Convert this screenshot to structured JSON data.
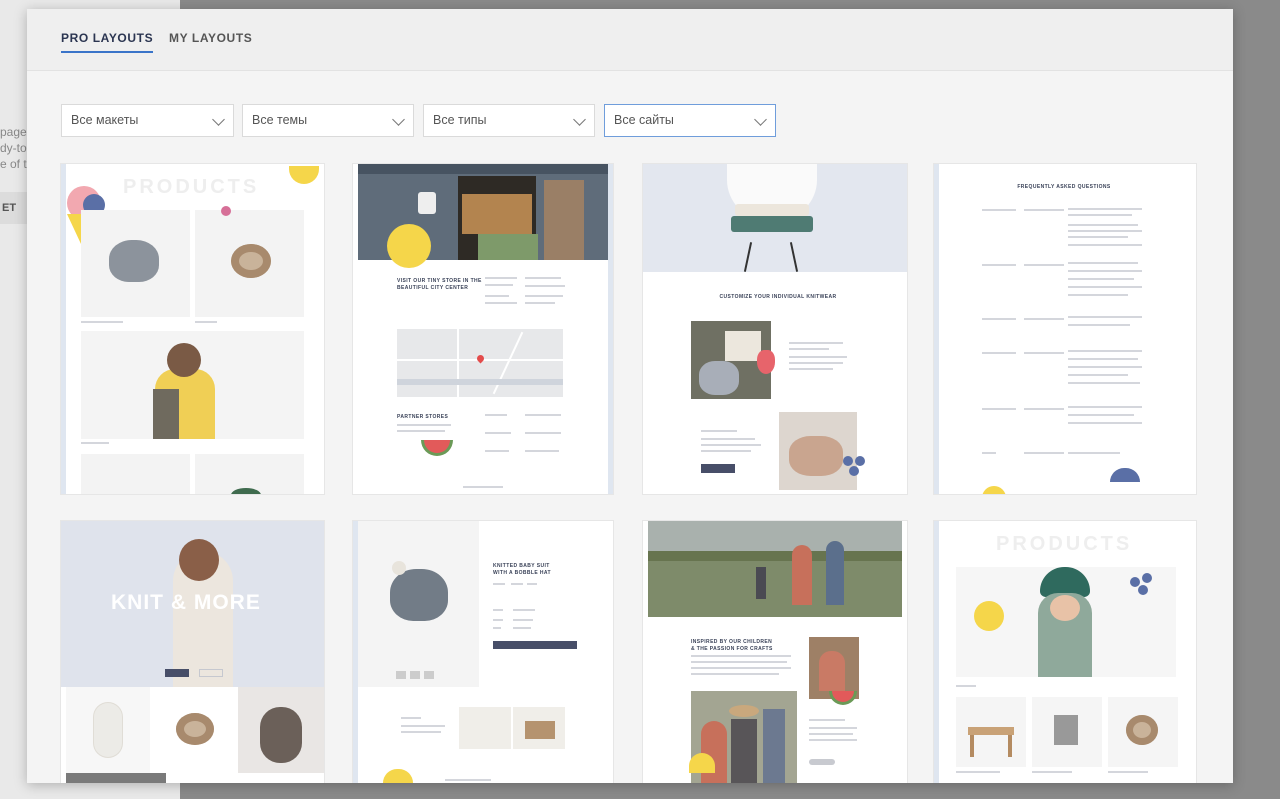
{
  "background_page": {
    "fragments": [
      "page.",
      "dy-to-",
      "e of t"
    ],
    "button_label": "ET"
  },
  "tabs": [
    {
      "label": "PRO LAYOUTS",
      "active": true
    },
    {
      "label": "MY LAYOUTS",
      "active": false
    }
  ],
  "filters": [
    {
      "value": "Все макеты"
    },
    {
      "value": "Все темы"
    },
    {
      "value": "Все типы"
    },
    {
      "value": "Все сайты",
      "focused": true
    }
  ],
  "layouts": {
    "products_1": {
      "faint_title": "PRODUCTS"
    },
    "store": {
      "heading": "VISIT OUR TINY STORE IN THE BEAUTIFUL CITY CENTER",
      "section": "PARTNER STORES"
    },
    "knitwear": {
      "heading": "CUSTOMIZE YOUR INDIVIDUAL KNITWEAR"
    },
    "faq": {
      "heading": "FREQUENTLY ASKED QUESTIONS"
    },
    "knit_more": {
      "hero": "KNIT & MORE"
    },
    "product_page": {
      "heading": "KNITTED BABY SUIT WITH A BOBBLE HAT"
    },
    "about": {
      "heading": "INSPIRED BY OUR CHILDREN & THE PASSION FOR CRAFTS"
    },
    "products_2": {
      "faint_title": "PRODUCTS"
    }
  },
  "colors": {
    "accent": "#3a74c9",
    "navy": "#2b3551",
    "page_bg": "#f4f4f4",
    "tint_blue": "#e6ebf3",
    "yellow": "#f5d64a",
    "pink": "#f2a8b0"
  }
}
